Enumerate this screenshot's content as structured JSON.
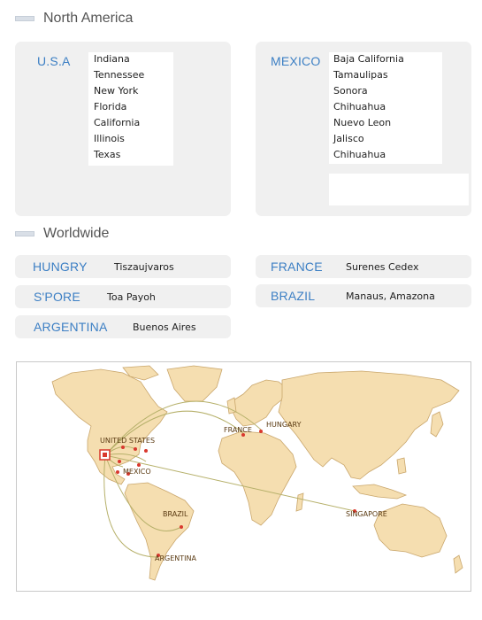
{
  "north_america": {
    "title": "North America",
    "usa": {
      "name": "U.S.A",
      "cities": [
        "Indiana",
        "Tennessee",
        "New York",
        "Florida",
        "California",
        "Illinois",
        "Texas"
      ]
    },
    "mexico": {
      "name": "MEXICO",
      "cities": [
        "Baja California",
        "Tamaulipas",
        "Sonora",
        "Chihuahua",
        "Nuevo Leon",
        "Jalisco",
        "Chihuahua"
      ]
    }
  },
  "worldwide": {
    "title": "Worldwide",
    "entries": [
      {
        "country": "HUNGRY",
        "location": "Tiszaujvaros"
      },
      {
        "country": "FRANCE",
        "location": "Surenes Cedex"
      },
      {
        "country": "S'PORE",
        "location": "Toa Payoh"
      },
      {
        "country": "BRAZIL",
        "location": "Manaus, Amazona"
      },
      {
        "country": "ARGENTINA",
        "location": "Buenos Aires"
      }
    ]
  },
  "map": {
    "labels": {
      "united_states": "UNITED STATES",
      "mexico": "MEXICO",
      "brazil": "BRAZIL",
      "argentina": "ARGENTINA",
      "france": "FRANCE",
      "hungary": "HUNGARY",
      "singapore": "SINGAPORE"
    },
    "colors": {
      "land": "#f5deb0",
      "land_outline": "#c9a66b",
      "route": "#b6b06a",
      "marker": "#d9382e",
      "marker_green": "#4c9a2a"
    }
  },
  "colors": {
    "accent": "#3c7fc4",
    "panel": "#f0f0f0"
  }
}
